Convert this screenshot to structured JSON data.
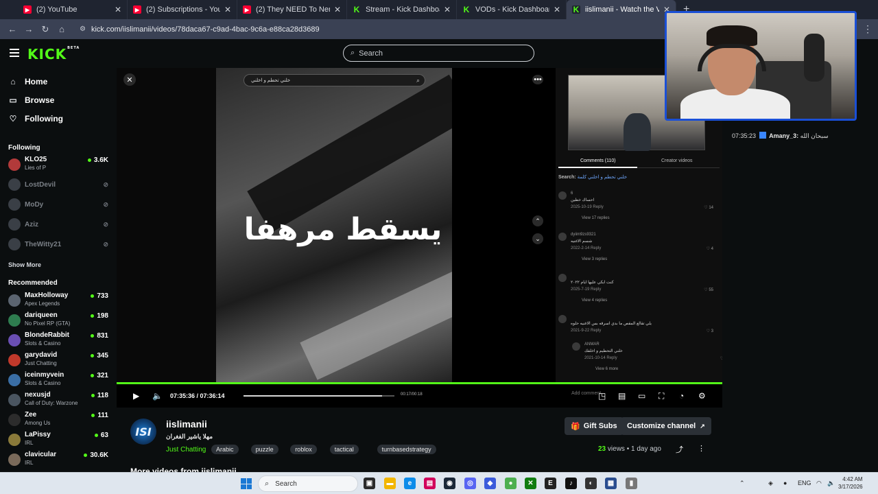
{
  "browser": {
    "tabs": [
      {
        "label": "(2) YouTube",
        "icon": "youtube-icon"
      },
      {
        "label": "(2) Subscriptions - YouTube",
        "icon": "youtube-icon"
      },
      {
        "label": "(2) They NEED To Nerf Cell - Yo",
        "icon": "youtube-icon"
      },
      {
        "label": "Stream - Kick Dashboard",
        "icon": "kick-icon"
      },
      {
        "label": "VODs - Kick Dashboard",
        "icon": "kick-icon"
      },
      {
        "label": "iislimanii - Watch the VOD",
        "icon": "kick-icon"
      }
    ],
    "url": "kick.com/iislimanii/videos/78daca67-c9ad-4bac-9c6a-e88ca28d3689"
  },
  "header": {
    "logo": "KICK",
    "logo_badge": "BETA",
    "search_placeholder": "Search"
  },
  "sidebar": {
    "nav": [
      {
        "label": "Home",
        "icon": "home-icon"
      },
      {
        "label": "Browse",
        "icon": "compass-icon"
      },
      {
        "label": "Following",
        "icon": "heart-icon"
      }
    ],
    "following_title": "Following",
    "following": [
      {
        "name": "KLO25",
        "game": "Lies of P",
        "viewers": "3.6K",
        "live": true,
        "color": "#b23a3a"
      },
      {
        "name": "LostDevil",
        "game": "",
        "viewers": "",
        "live": false,
        "color": "#3a3f46"
      },
      {
        "name": "MoDy",
        "game": "",
        "viewers": "",
        "live": false,
        "color": "#3a3f46"
      },
      {
        "name": "Aziz",
        "game": "",
        "viewers": "",
        "live": false,
        "color": "#3a3f46"
      },
      {
        "name": "TheWitty21",
        "game": "",
        "viewers": "",
        "live": false,
        "color": "#3a3f46"
      }
    ],
    "show_more": "Show More",
    "recommended_title": "Recommended",
    "recommended": [
      {
        "name": "MaxHolloway",
        "game": "Apex Legends",
        "viewers": "733",
        "color": "#5b6470"
      },
      {
        "name": "dariqueen",
        "game": "No Pixel RP (GTA)",
        "viewers": "198",
        "color": "#2e7d4f"
      },
      {
        "name": "BlondeRabbit",
        "game": "Slots & Casino",
        "viewers": "831",
        "color": "#6a4fb3"
      },
      {
        "name": "garydavid",
        "game": "Just Chatting",
        "viewers": "345",
        "color": "#c0392b"
      },
      {
        "name": "iceinmyvein",
        "game": "Slots & Casino",
        "viewers": "321",
        "color": "#3a6ea5"
      },
      {
        "name": "nexusjd",
        "game": "Call of Duty: Warzone",
        "viewers": "118",
        "color": "#4a5560"
      },
      {
        "name": "Zee",
        "game": "Among Us",
        "viewers": "111",
        "color": "#2c2c2c"
      },
      {
        "name": "LaPissy",
        "game": "IRL",
        "viewers": "63",
        "color": "#8a7a3a"
      },
      {
        "name": "clavicular",
        "game": "IRL",
        "viewers": "30.6K",
        "color": "#7a6a5a"
      }
    ]
  },
  "video": {
    "overlay_search": "خلني تحطم و اخلني",
    "overlay_text": "يسقط مرهفا",
    "comments_tab": "Comments (110)",
    "creator_tab": "Creator videos",
    "comments_search_label": "Search:",
    "comments_search_term": "خلني تحطم و اخلني كلمة",
    "comments": [
      {
        "user": "6",
        "text": "احساك خطين",
        "meta": "2025-10-19   Reply",
        "likes": "14",
        "replies": "View 17 replies"
      },
      {
        "user": "dyiim9zs9321",
        "text": "شسم الاغنيه",
        "meta": "2022-2-14   Reply",
        "likes": "4",
        "replies": "View 3 replies"
      },
      {
        "user": "",
        "text": "كنت ابكي عليها ايام ٢٠٢٢",
        "meta": "2025-7-19   Reply",
        "likes": "55",
        "replies": "View 4 replies"
      },
      {
        "user": "",
        "text": "يلي تقالع المقص ما بدي اسرقه بس الاغنيه حلوه",
        "meta": "2021-9-22   Reply",
        "likes": "3",
        "replies": ""
      },
      {
        "user": "ANMAR",
        "text": "خلني التحطيم و اخلفك",
        "meta": "2021-10-14   Reply",
        "likes": "6",
        "replies": "View 6 more"
      }
    ],
    "progress": 1.0,
    "time": "07:35:36 / 07:36:14",
    "inner_time": "00:17/00:18",
    "inner_progress": 0.92,
    "add_comment": "Add comment"
  },
  "channel": {
    "avatar_text": "ISI",
    "name": "iislimanii",
    "title": "مهلا ياشير الفغران",
    "category": "Just Chatting",
    "tags": [
      "Arabic",
      "puzzle",
      "roblox",
      "tactical",
      "turnbasedstrategy"
    ],
    "gift_subs": "Gift Subs",
    "customize": "Customize channel",
    "views_count": "23",
    "views_label": "views",
    "age": "1 day ago",
    "more_videos": "More videos from iislimanii"
  },
  "chat": {
    "timestamp": "07:35:23",
    "user": "Amany_3:",
    "message": "سبحان الله"
  },
  "taskbar": {
    "search": "Search",
    "lang": "ENG",
    "time": "4:42 AM",
    "date": "3/17/2026"
  },
  "colors": {
    "brand": "#53fc18",
    "background": "#0b0e0f",
    "webcam_border": "#1a4fd6"
  }
}
